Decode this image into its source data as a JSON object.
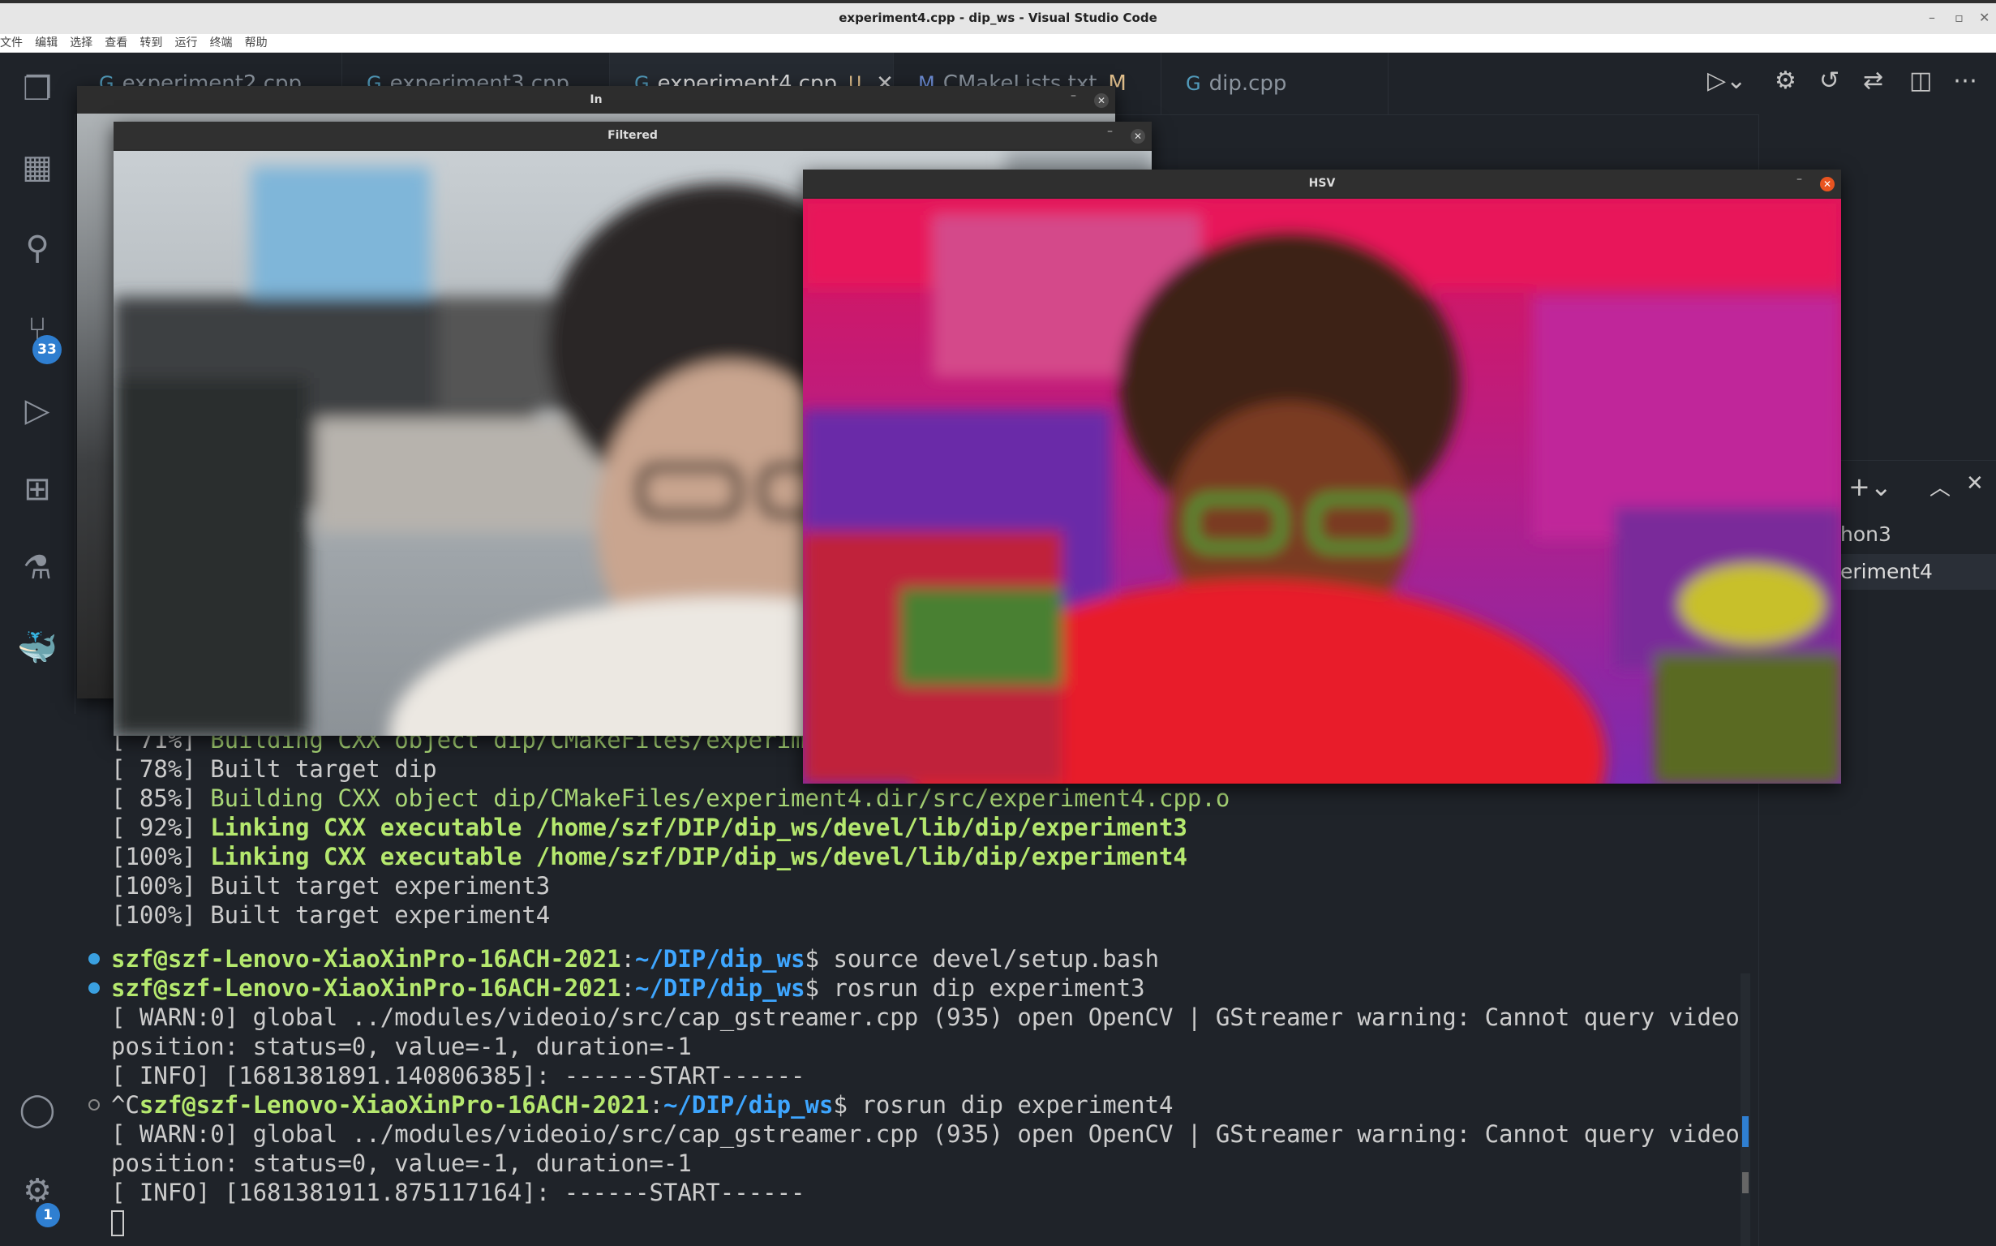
{
  "window": {
    "title": "experiment4.cpp - dip_ws - Visual Studio Code"
  },
  "menu": [
    "文件",
    "编辑",
    "选择",
    "查看",
    "转到",
    "运行",
    "终端",
    "帮助"
  ],
  "tabs": [
    {
      "label": "experiment2.cpp",
      "badge": ""
    },
    {
      "label": "experiment3.cpp",
      "badge": ""
    },
    {
      "label": "experiment4.cpp",
      "badge": "U"
    },
    {
      "label": "CMakeLists.txt",
      "badge": "M"
    },
    {
      "label": "dip.cpp",
      "badge": ""
    }
  ],
  "activity": {
    "source_control_badge": "33",
    "settings_badge": "1"
  },
  "windows": {
    "in": "In",
    "filtered": "Filtered",
    "hsv": "HSV"
  },
  "panel": {
    "items": [
      "hon3",
      "eriment4"
    ]
  },
  "terminal": {
    "lines": [
      {
        "prefix": "[ 71%] ",
        "text": "Building CXX object dip/CMakeFiles/experiment3.dir/src/experiment3.cpp.o",
        "style": "green"
      },
      {
        "prefix": "[ 78%] ",
        "text": "Built target dip",
        "style": "plain"
      },
      {
        "prefix": "[ 85%] ",
        "text": "Building CXX object dip/CMakeFiles/experiment4.dir/src/experiment4.cpp.o",
        "style": "green"
      },
      {
        "prefix": "[ 92%] ",
        "text": "Linking CXX executable /home/szf/DIP/dip_ws/devel/lib/dip/experiment3",
        "style": "bold-green"
      },
      {
        "prefix": "[100%] ",
        "text": "Linking CXX executable /home/szf/DIP/dip_ws/devel/lib/dip/experiment4",
        "style": "bold-green"
      },
      {
        "prefix": "[100%] ",
        "text": "Built target experiment3",
        "style": "plain"
      },
      {
        "prefix": "[100%] ",
        "text": "Built target experiment4",
        "style": "plain"
      }
    ],
    "prompt_user": "szf@szf-Lenovo-XiaoXinPro-16ACH-2021",
    "prompt_path": "~/DIP/dip_ws",
    "cmd1": " source devel/setup.bash",
    "cmd2": " rosrun dip experiment3",
    "cmd3": " rosrun dip experiment4",
    "ctrl_c": "^C",
    "warn1": "[ WARN:0] global ../modules/videoio/src/cap_gstreamer.cpp (935) open OpenCV | GStreamer warning: Cannot query video",
    "warn2": "position: status=0, value=-1, duration=-1",
    "info1": "[ INFO] [1681381891.140806385]: ------START------",
    "info2": "[ INFO] [1681381911.875117164]: ------START------"
  }
}
